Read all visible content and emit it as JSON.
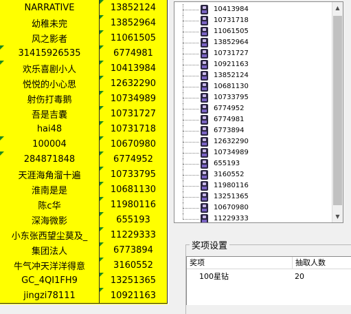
{
  "sheet": {
    "rows": [
      {
        "name": "NARRATIVE",
        "id": "13852124",
        "flag": false
      },
      {
        "name": "幼稚未完",
        "id": "13852964",
        "flag": false
      },
      {
        "name": "风之影者",
        "id": "11061505",
        "flag": false
      },
      {
        "name": "31415926535",
        "id": "6774981",
        "flag": true
      },
      {
        "name": "欢乐喜剧小人",
        "id": "10413984",
        "flag": true
      },
      {
        "name": "悦悦的小心思",
        "id": "12632290",
        "flag": false
      },
      {
        "name": "射伤打毒鹅",
        "id": "10734989",
        "flag": false
      },
      {
        "name": "吾是吉囊",
        "id": "10731727",
        "flag": false
      },
      {
        "name": "hai48",
        "id": "10731718",
        "flag": false
      },
      {
        "name": "100004",
        "id": "10670980",
        "flag": true
      },
      {
        "name": "284871848",
        "id": "6774952",
        "flag": true
      },
      {
        "name": "天涯海角溜十遍",
        "id": "10733795",
        "flag": false
      },
      {
        "name": "淮南是是",
        "id": "10681130",
        "flag": false
      },
      {
        "name": "陈c华",
        "id": "11980116",
        "flag": false
      },
      {
        "name": "深海微影",
        "id": "655193",
        "flag": false
      },
      {
        "name": "小东张西望尘莫及_",
        "id": "11229333",
        "flag": false
      },
      {
        "name": "集团法人",
        "id": "6773894",
        "flag": false
      },
      {
        "name": "牛气冲天洋洋得意",
        "id": "3160552",
        "flag": false
      },
      {
        "name": "GC_4QI1FH9",
        "id": "13251365",
        "flag": false
      },
      {
        "name": "jingzi78111",
        "id": "10921163",
        "flag": false
      }
    ]
  },
  "tree": {
    "items": [
      "10413984",
      "10731718",
      "11061505",
      "13852964",
      "10731727",
      "10921163",
      "13852124",
      "10681130",
      "10733795",
      "6774952",
      "6774981",
      "6773894",
      "12632290",
      "10734989",
      "655193",
      "3160552",
      "11980116",
      "13251365",
      "10670980",
      "11229333"
    ],
    "item_icon": "user-avatar-icon",
    "scroll_up_glyph": "▲",
    "scroll_down_glyph": "▼"
  },
  "prize": {
    "title": "奖项设置",
    "columns": [
      "奖项",
      "抽取人数"
    ],
    "rows": [
      {
        "item": "100星钻",
        "count": "20"
      }
    ]
  },
  "colors": {
    "sheet_bg": "#ffff00",
    "flag_triangle": "#1e8a1e"
  }
}
